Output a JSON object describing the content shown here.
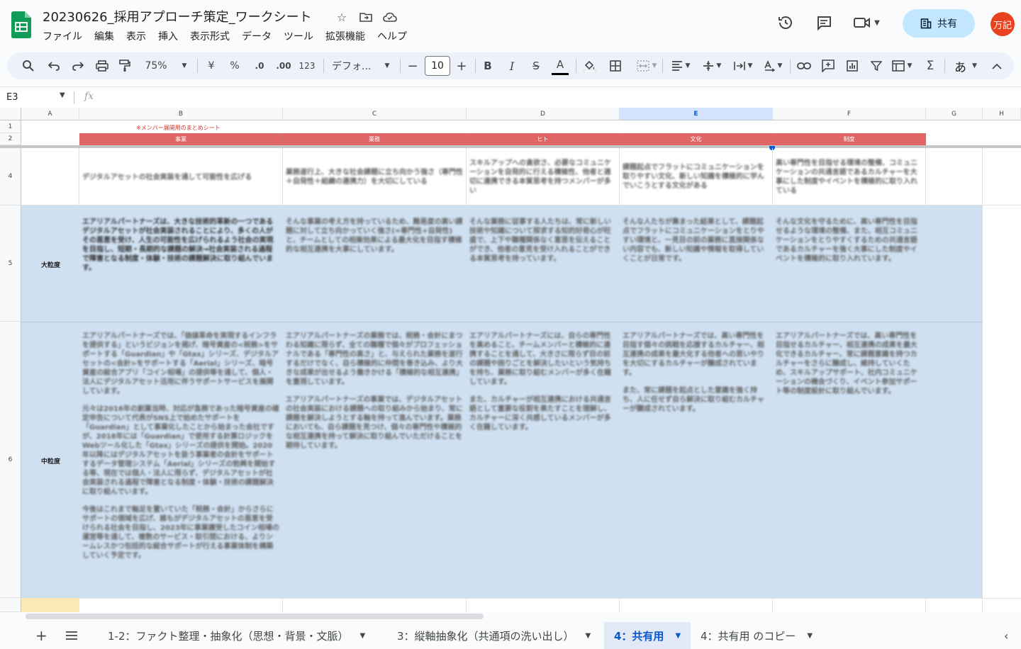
{
  "app": {
    "doc_title": "20230626_採用アプローチ策定_ワークシート",
    "menu": [
      "ファイル",
      "編集",
      "表示",
      "挿入",
      "表示形式",
      "データ",
      "ツール",
      "拡張機能",
      "ヘルプ"
    ],
    "share_label": "共有",
    "avatar_text": "万記"
  },
  "toolbar": {
    "zoom": "75%",
    "currency": "¥",
    "percent": "%",
    "dec_decrease": ".0",
    "dec_increase": ".00",
    "number_format": "123",
    "font_name": "デフォ...",
    "font_size": "10",
    "minus": "−",
    "plus": "+",
    "bold": "B",
    "italic": "I",
    "strike": "S",
    "text_color": "A",
    "input_tool": "あ"
  },
  "formula_bar": {
    "name_box": "E3",
    "fx": "fx"
  },
  "columns": [
    "A",
    "B",
    "C",
    "D",
    "E",
    "F",
    "G",
    "H"
  ],
  "rows": [
    "1",
    "2",
    "4",
    "5",
    "6"
  ],
  "sheet": {
    "note": "※メンバー展開用のまとめシート",
    "headers": [
      "事業",
      "業務",
      "ヒト",
      "文化",
      "制度"
    ],
    "row_labels": {
      "r5": "大粒度",
      "r6": "中粒度"
    },
    "r4": [
      "デジタルアセットの社会実装を通して可能性を広げる",
      "業務遂行上、大きな社会課題に立ち向かう強さ（専門性＋自発性＋組織の連携力）を大切にしている",
      "スキルアップへの貪欲さ、必要なコミュニケーションを自発的に行える積極性、他者と適切に連携できる本質思考を持つメンバーが多い",
      "課題起点でフラットにコミュニケーションを取りやすい文化、新しい知識を積極的に学んでいこうとする文化がある",
      "高い専門性を目指せる環境の整備、コミュニケーションの共通言語であるカルチャーを大事にした制度やイベントを積極的に取り入れている"
    ],
    "r5": [
      "エアリアルパートナーズは、大きな技術的革新の一つであるデジタルアセットが社会実装されることにより、多くの人がその恩恵を受け、人生の可能性を広げられるよう社会の実現を目指し、短期・長期的な課題の解決→社会実装される過程で障害となる制度・体験・技術の課題解決に取り組んでいます。",
      "そんな事業の考え方を持っているため、難易度の高い課題に対して立ち向かっていく強さ(=専門性+自発性)と、チームとしての相乗効果による最大化を目指す積極的な相互連携を大事にしています。",
      "そんな業務に従事する人たちは、常に新しい技術や知識について探求する知的好奇心が旺盛で、上下や職種関係なく意思を伝えることができ、他者の意見を受け入れることができる本質思考を持っています。",
      "そんな人たちが集まった結果として、課題起点でフラットにコミュニケーションをとりやすい環境と、一見目の前の業務に直接関係ない内容でも、新しい知識や情報を取得していくことが日常です。",
      "そんな文化を守るために、高い専門性を目指せるような環境の整備、また、相互コミュニケーションをとりやすくするための共通言語であるカルチャーを強く大事にした制度やイベントを積極的に取り入れています。"
    ],
    "r6": [
      "エアリアルパートナーズでは、「価値革命を実現するインフラを提供する」というビジョンを掲げ、暗号資産の<税務>をサポートする「Guardian」や「Gtax」シリーズ、デジタルアセットの<会計>をサポートする「Aerial」シリーズ、暗号資産の総合アプリ「コイン相場」の提供等を通して、個人・法人にデジタルアセット活用に伴うサポートサービスを展開しています。",
      "元々は2016年の創業当時、対応が急務であった暗号資産の確定申告について代表がSNS上で始めたサポートを「Guardian」として事業化したことから始まった会社ですが、2018年には「Guardian」で使用する計算ロジックをWebツール化した「Gtax」シリーズの提供を開始。2020年以降にはデジタルアセットを扱う事業者の会計をサポートするデータ管理システム「Aerial」シリーズの勃興を開始する等、現在では個人・法人に限らず、デジタルアセットが社会実装される過程で障害となる制度・体験・技術の課題解決に取り組んでいます。",
      "今後はこれまで軸足を置いていた「税務・会計」からさらにサポートの領域を広げ、誰もがデジタルアセットの恩恵を受けられる社会を目指し、2023年に事業譲受したコイン相場の運営等を通して、複数のサービス・取引間における、よりシームレスかつ包括的な総合サポートが行える事業体制を構築していく予定です。",
      "エアリアルパートナーズの業務では、税務・会計にまつわる知識に限らず、全ての職種で個々がプロフェッショナルである「専門性の高さ」と、与えられた業務を遂行するだけでなく、自ら積極的に仲間を巻き込み、より大きな成果が出せるよう働きかける「積極的な相互連携」を重視しています。",
      "エアリアルパートナーズの事業では、デジタルアセットの社会実装における課題への取り組みから始まり、常に課題を解決しようとする軸を持って進んでいます。業務においても、自ら課題を見つけ、個々の専門性や積極的な相互連携を持って解決に取り組んでいただけることを期待しています。",
      "エアリアルパートナーズには、自らの専門性を高めること、チームメンバーと積極的に連携することを通して、大きさに限らず目の前の課題や困りごとを解決したいという気持ちを持ち、業務に取り組むメンバーが多く在籍しています。",
      "また、カルチャーが相互連携における共通言語として重要な役割を果たすことを理解し、カルチャーに深く共感しているメンバーが多く在籍しています。",
      "エアリアルパートナーズでは、高い専門性を目指す個々の挑戦を応援するカルチャー、相互連携の成果を最大化する他者への思いやりを大切にするカルチャーが醸成されています。",
      "また、常に課題を起点とした意識を強く持ち、人に任せず自ら解決に取り組むカルチャーが醸成されています。",
      "エアリアルパートナーズでは、高い専門性を目指せるカルチャー、相互連携の成果を最大化できるカルチャー、常に課題意識を持つカルチャーをさらに醸成し、維持していくため、スキルアップサポート、社内コミュニケーションの機会づくり、イベント参加サポート等の制度設計に取り組んでいます。"
    ]
  },
  "sheet_tabs": [
    "1-2：ファクト整理・抽象化（思想・背景・文脈）",
    "3：縦軸抽象化（共通項の洗い出し）",
    "4：共有用",
    "4：共有用 のコピー"
  ],
  "colors": {
    "header_band": "#e06666",
    "selected_fill": "#cfe0f1",
    "share_button": "#c2e7ff",
    "avatar": "#e8431e",
    "note_red": "#d93025"
  }
}
